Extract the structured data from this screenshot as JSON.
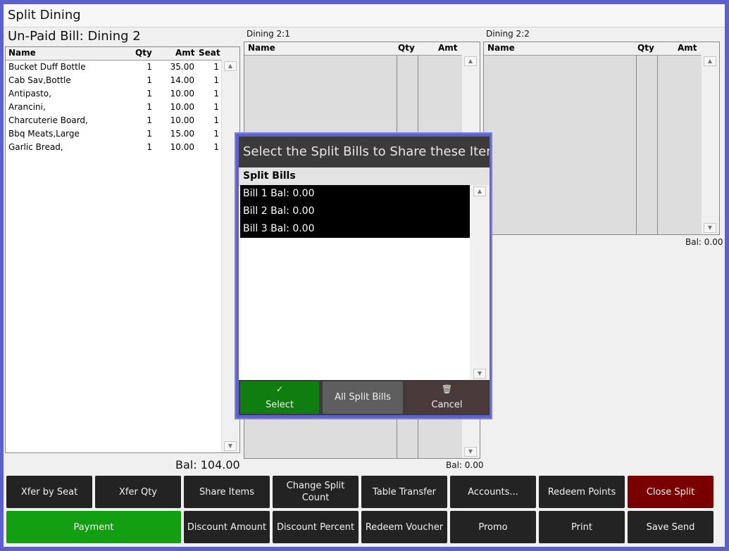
{
  "window": {
    "title": "Split Dining"
  },
  "unpaid": {
    "heading": "Un-Paid Bill: Dining 2",
    "columns": {
      "name": "Name",
      "qty": "Qty",
      "amt": "Amt",
      "seat": "Seat"
    },
    "rows": [
      {
        "name": "Bucket Duff Bottle",
        "qty": "1",
        "amt": "35.00",
        "seat": "1"
      },
      {
        "name": "Cab Sav,Bottle",
        "qty": "1",
        "amt": "14.00",
        "seat": "1"
      },
      {
        "name": "Antipasto,",
        "qty": "1",
        "amt": "10.00",
        "seat": "1"
      },
      {
        "name": "Arancini,",
        "qty": "1",
        "amt": "10.00",
        "seat": "1"
      },
      {
        "name": "Charcuterie Board,",
        "qty": "1",
        "amt": "10.00",
        "seat": "1"
      },
      {
        "name": "Bbq Meats,Large",
        "qty": "1",
        "amt": "15.00",
        "seat": "1"
      },
      {
        "name": "Garlic Bread,",
        "qty": "1",
        "amt": "10.00",
        "seat": "1"
      }
    ],
    "balance": "Bal: 104.00"
  },
  "split1": {
    "label": "Dining 2:1",
    "columns": {
      "name": "Name",
      "qty": "Qty",
      "amt": "Amt"
    },
    "balance": "Bal: 0.00"
  },
  "split2": {
    "label": "Dining 2:2",
    "columns": {
      "name": "Name",
      "qty": "Qty",
      "amt": "Amt"
    },
    "balance": "Bal: 0.00"
  },
  "dialog": {
    "title": "Select the Split Bills to Share these Items",
    "list_header": "Split Bills",
    "items": [
      "Bill 1 Bal: 0.00",
      "Bill 2 Bal: 0.00",
      "Bill 3 Bal: 0.00"
    ],
    "select_label": "Select",
    "select_icon": "✓",
    "all_label": "All Split Bills",
    "cancel_label": "Cancel",
    "cancel_icon": "🗑"
  },
  "toolbar": {
    "row1": [
      "Xfer by Seat",
      "Xfer Qty",
      "Share Items",
      "Change Split Count",
      "Table Transfer",
      "Accounts...",
      "Redeem Points",
      "Close Split"
    ],
    "row2": [
      "Payment",
      "Discount Amount",
      "Discount Percent",
      "Redeem Voucher",
      "Promo",
      "Print",
      "Save Send"
    ]
  },
  "colors": {
    "accent_border": "#5c5fcf",
    "select_green": "#0f7d0f",
    "payment_green": "#12a012",
    "close_red": "#7a0000"
  },
  "icons": {
    "scroll_up": "scroll-up-arrow-icon",
    "scroll_down": "scroll-down-arrow-icon",
    "select": "check-icon",
    "cancel": "trash-icon"
  }
}
